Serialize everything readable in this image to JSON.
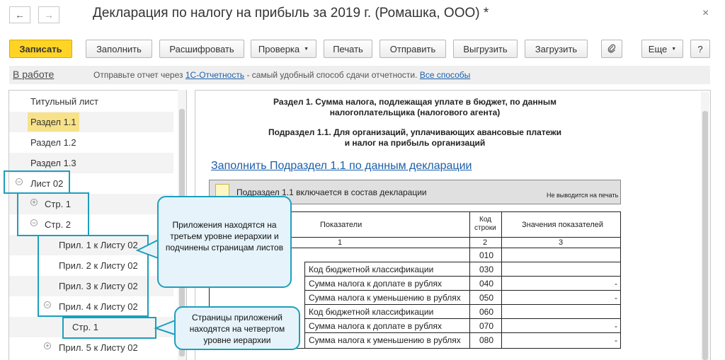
{
  "window": {
    "title": "Декларация по налогу на прибыль за 2019 г. (Ромашка, ООО) *",
    "back_icon": "←",
    "forward_icon": "→",
    "close_icon": "×"
  },
  "toolbar": {
    "save": "Записать",
    "fill": "Заполнить",
    "decode": "Расшифровать",
    "check": "Проверка",
    "print": "Печать",
    "send": "Отправить",
    "export": "Выгрузить",
    "import": "Загрузить",
    "attach_icon": "paperclip-icon",
    "more": "Еще",
    "help": "?"
  },
  "info": {
    "status": "В работе",
    "message_prefix": "Отправьте отчет через",
    "link_1c": "1С-Отчетность",
    "message_suffix": "- самый удобный способ сдачи отчетности.",
    "all_ways": "Все способы"
  },
  "tree": {
    "items": [
      {
        "label": "Титульный лист"
      },
      {
        "label": "Раздел 1.1"
      },
      {
        "label": "Раздел 1.2"
      },
      {
        "label": "Раздел 1.3"
      },
      {
        "label": "Лист 02"
      },
      {
        "label": "Стр. 1"
      },
      {
        "label": "Стр. 2"
      },
      {
        "label": "Прил. 1 к Листу 02"
      },
      {
        "label": "Прил. 2 к Листу 02"
      },
      {
        "label": "Прил. 3 к Листу 02"
      },
      {
        "label": "Прил. 4 к Листу 02"
      },
      {
        "label": "Стр. 1"
      },
      {
        "label": "Прил. 5 к Листу 02"
      }
    ]
  },
  "form": {
    "section_title_1": "Раздел 1. Сумма налога, подлежащая уплате в бюджет, по данным",
    "section_title_2": "налогоплательщика (налогового агента)",
    "subsection_title_1": "Подраздел 1.1. Для организаций, уплачивающих авансовые платежи",
    "subsection_title_2": "и налог на прибыль организаций",
    "fill_link": "Заполнить Подраздел 1.1 по данным декларации",
    "include_label": "Подраздел 1.1 включается в состав декларации",
    "no_print": "Не выводится на печать",
    "table": {
      "col_indicators": "Показатели",
      "col_code_1": "Код",
      "col_code_2": "строки",
      "col_values": "Значения показателей",
      "num_1": "1",
      "num_2": "2",
      "num_3": "3",
      "rows": [
        {
          "label": "",
          "code": "010",
          "value": ""
        },
        {
          "label": "Код бюджетной классификации",
          "code": "030",
          "value": ""
        },
        {
          "label": "Сумма налога к доплате в рублях",
          "code": "040",
          "value": "-"
        },
        {
          "label": "Сумма налога к уменьшению в рублях",
          "code": "050",
          "value": "-"
        },
        {
          "label": "Код бюджетной классификации",
          "code": "060",
          "value": ""
        },
        {
          "label": "Сумма налога к доплате в рублях",
          "code": "070",
          "value": "-"
        },
        {
          "label": "Сумма налога к уменьшению в рублях",
          "code": "080",
          "value": "-"
        }
      ]
    }
  },
  "callouts": {
    "first": "Приложения находятся на третьем уровне иерархии и подчинены страницам листов",
    "second": "Страницы приложений находятся на четвертом уровне иерархии"
  }
}
